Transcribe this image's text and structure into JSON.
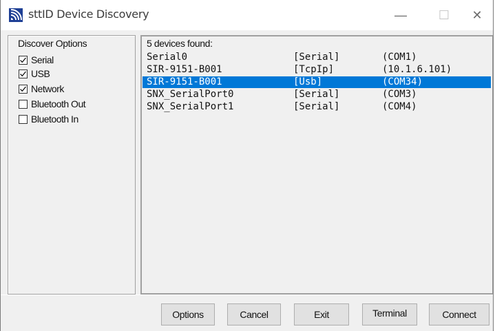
{
  "window": {
    "title": "sttID Device Discovery",
    "controls": {
      "minimize": "—",
      "maximize": "☐",
      "close": "✕"
    }
  },
  "discover_options": {
    "title": "Discover Options",
    "items": [
      {
        "label": "Serial",
        "checked": true
      },
      {
        "label": "USB",
        "checked": true
      },
      {
        "label": "Network",
        "checked": true
      },
      {
        "label": "Bluetooth Out",
        "checked": false
      },
      {
        "label": "Bluetooth In",
        "checked": false
      }
    ]
  },
  "devices": {
    "summary": "5 devices found:",
    "selected_index": 2,
    "rows": [
      {
        "name": "Serial0",
        "type": "[Serial]",
        "port": "(COM1)"
      },
      {
        "name": "SIR-9151-B001",
        "type": "[TcpIp]",
        "port": "(10.1.6.101)"
      },
      {
        "name": "SIR-9151-B001",
        "type": "[Usb]",
        "port": "(COM34)"
      },
      {
        "name": "SNX_SerialPort0",
        "type": "[Serial]",
        "port": "(COM3)"
      },
      {
        "name": "SNX_SerialPort1",
        "type": "[Serial]",
        "port": "(COM4)"
      }
    ]
  },
  "buttons": {
    "options": "Options",
    "cancel": "Cancel",
    "exit": "Exit",
    "terminal": "Terminal",
    "connect": "Connect"
  },
  "colors": {
    "selection": "#0078d7",
    "app_icon": "#1e3f95"
  },
  "icons": {
    "app": "signal-waves-icon",
    "check": "checkmark-icon"
  }
}
